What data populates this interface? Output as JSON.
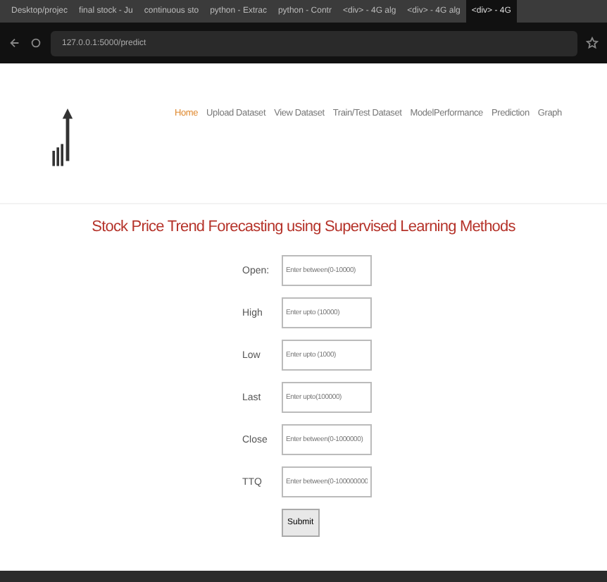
{
  "browser": {
    "tabs": [
      {
        "label": "Desktop/projec",
        "selected": false
      },
      {
        "label": "final stock - Ju",
        "selected": false
      },
      {
        "label": "continuous sto",
        "selected": false
      },
      {
        "label": "python - Extrac",
        "selected": false
      },
      {
        "label": "python - Contr",
        "selected": false
      },
      {
        "label": "<div> - 4G alg",
        "selected": false
      },
      {
        "label": "<div> - 4G alg",
        "selected": false
      },
      {
        "label": "<div> - 4G",
        "selected": true
      }
    ],
    "address": "127.0.0.1:5000/predict"
  },
  "nav": [
    {
      "label": "Home",
      "selected": true
    },
    {
      "label": "Upload Dataset",
      "selected": false
    },
    {
      "label": "View Dataset",
      "selected": false
    },
    {
      "label": "Train/Test Dataset",
      "selected": false
    },
    {
      "label": "ModelPerformance",
      "selected": false
    },
    {
      "label": "Prediction",
      "selected": false
    },
    {
      "label": "Graph",
      "selected": false
    }
  ],
  "title": "Stock Price Trend Forecasting using Supervised Learning Methods",
  "form": {
    "fields": [
      {
        "label": "Open:",
        "placeholder": "Enter between(0-10000)"
      },
      {
        "label": "High",
        "placeholder": "Enter upto (10000)"
      },
      {
        "label": "Low",
        "placeholder": "Enter upto (1000)"
      },
      {
        "label": "Last",
        "placeholder": "Enter upto(100000)"
      },
      {
        "label": "Close",
        "placeholder": "Enter between(0-1000000)"
      },
      {
        "label": "TTQ",
        "placeholder": "Enter between(0-100000000"
      }
    ],
    "submit": "Submit"
  }
}
